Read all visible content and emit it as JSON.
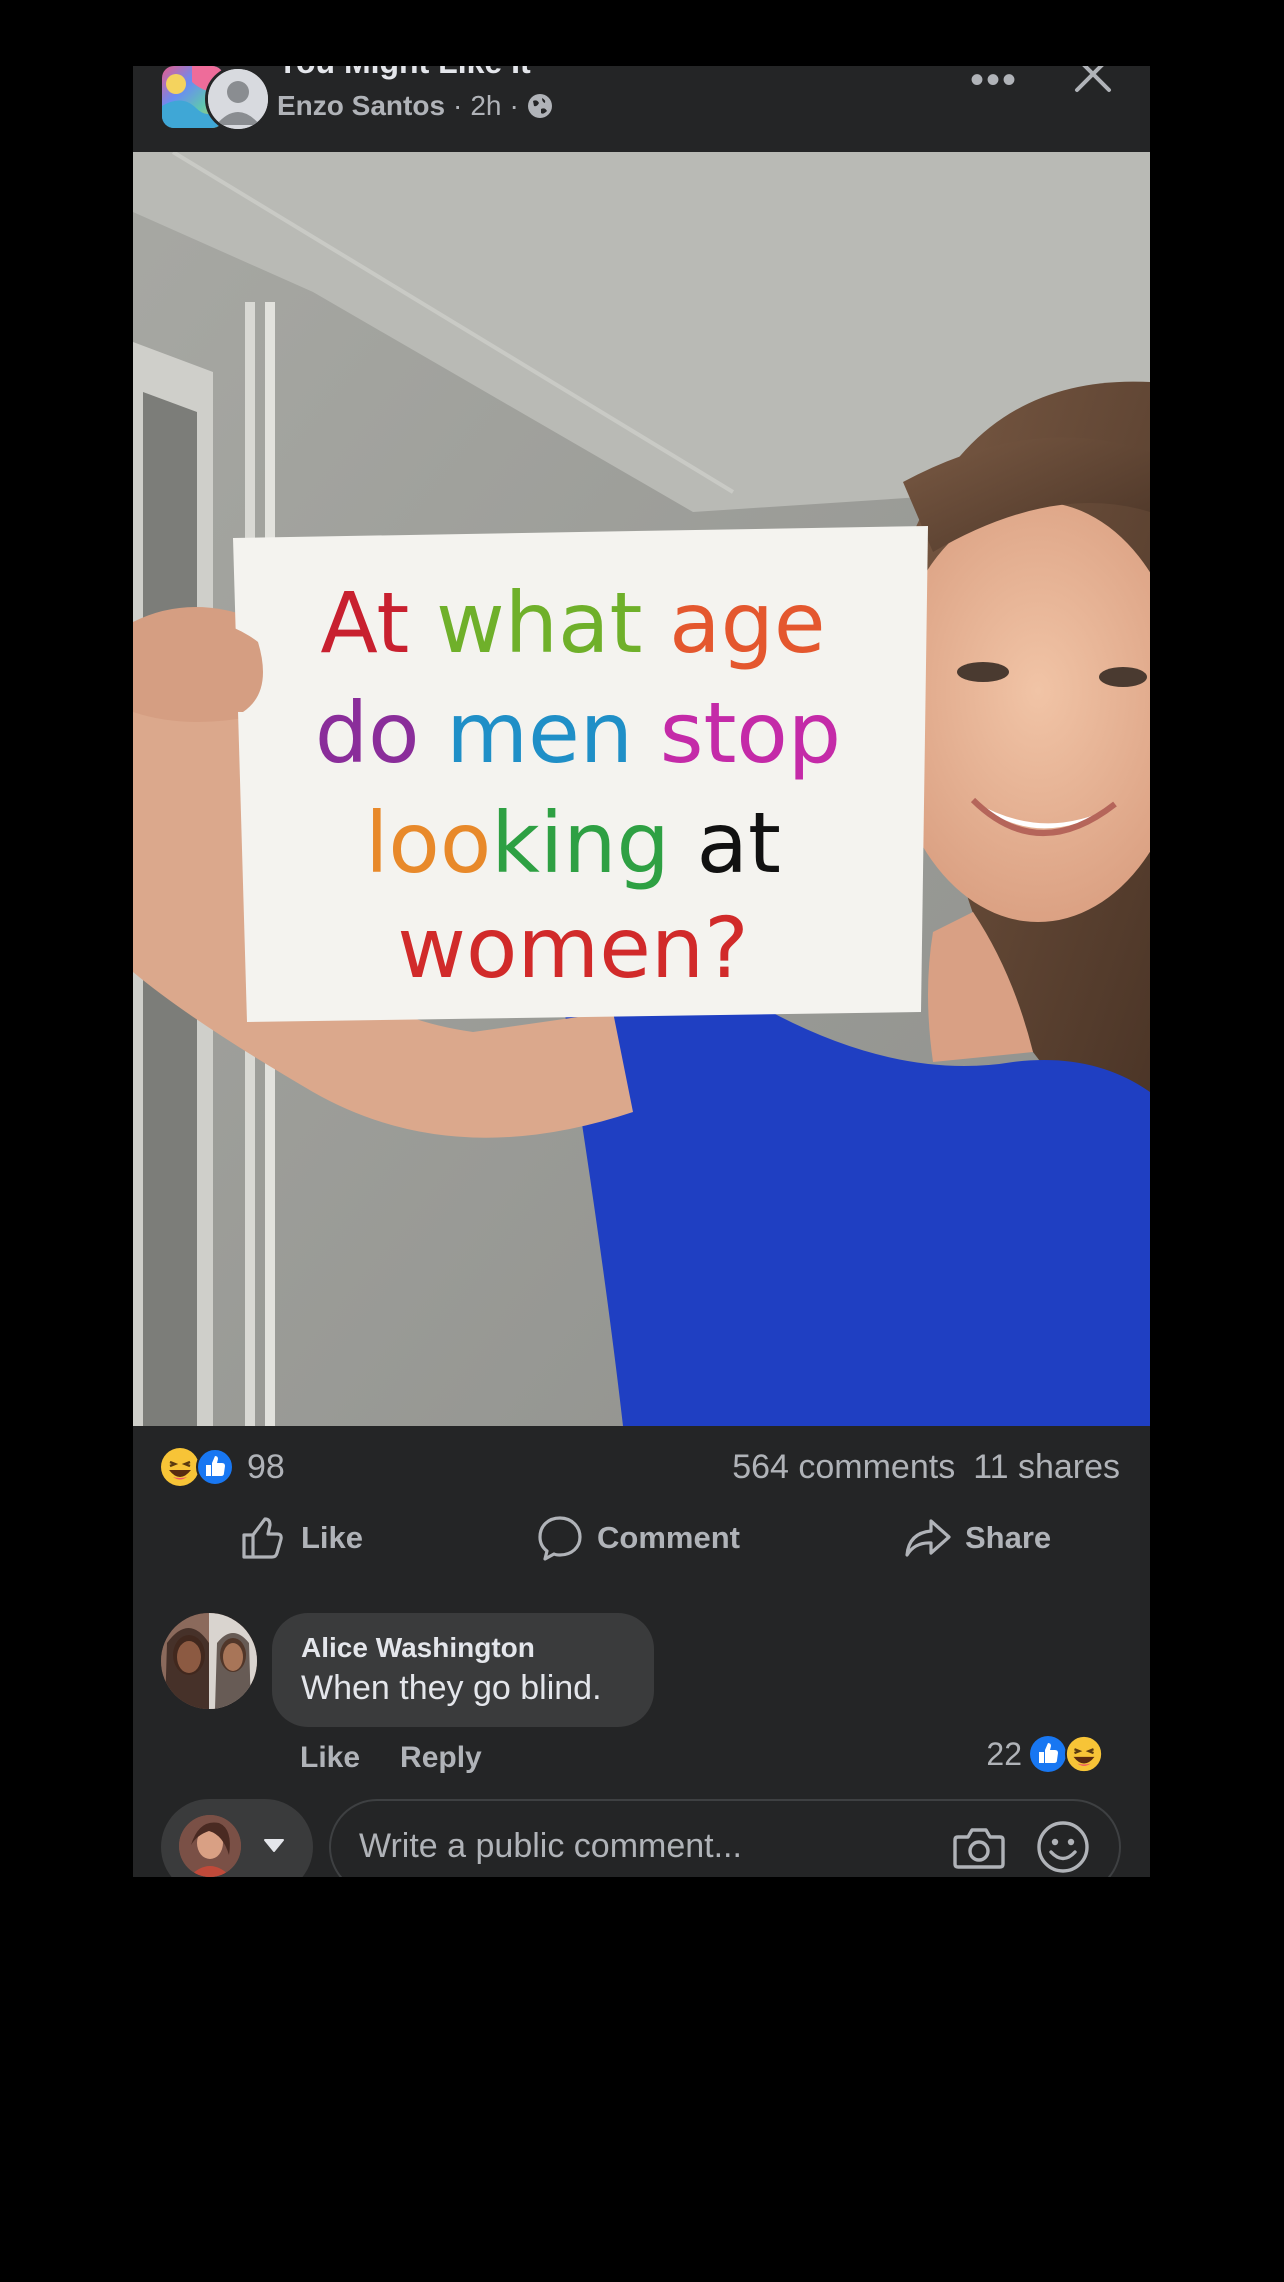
{
  "header": {
    "group_title": "You Might Like It",
    "author": "Enzo Santos",
    "time": "2h",
    "separator": "·"
  },
  "photo": {
    "sign_lines": [
      [
        {
          "text": "At",
          "color": "#c8202f"
        },
        {
          "text": "what",
          "color": "#6fb02a"
        },
        {
          "text": "age",
          "color": "#e4572e"
        }
      ],
      [
        {
          "text": "do",
          "color": "#8a2d9a"
        },
        {
          "text": "men",
          "color": "#1f8fc7"
        },
        {
          "text": "stop",
          "color": "#c42aa8"
        }
      ],
      [
        {
          "text": "loo",
          "color": "#e8892a"
        },
        {
          "text": "k",
          "color": "#2ea043"
        },
        {
          "text": "ing",
          "color": "#2ea043"
        },
        {
          "text": "at",
          "color": "#111111"
        }
      ],
      [
        {
          "text": "women?",
          "color": "#d12a2a"
        }
      ]
    ]
  },
  "stats": {
    "reaction_count": "98",
    "comments": "564 comments",
    "shares": "11 shares"
  },
  "actions": {
    "like": "Like",
    "comment": "Comment",
    "share": "Share"
  },
  "comment": {
    "author": "Alice Washington",
    "text": "When they go blind.",
    "like": "Like",
    "reply": "Reply",
    "reaction_count": "22"
  },
  "composer": {
    "placeholder": "Write a public comment..."
  },
  "colors": {
    "card_bg": "#242526",
    "bubble_bg": "#3a3b3c",
    "like_blue": "#1877f2",
    "shirt_blue": "#1f3fc2",
    "muted_text": "#b0b3b8"
  },
  "icons": [
    "globe-icon",
    "more-icon",
    "close-icon",
    "like-reaction-icon",
    "haha-reaction-icon",
    "thumbs-up-icon",
    "comment-icon",
    "share-icon",
    "caret-down-icon",
    "camera-icon",
    "emoji-icon"
  ]
}
